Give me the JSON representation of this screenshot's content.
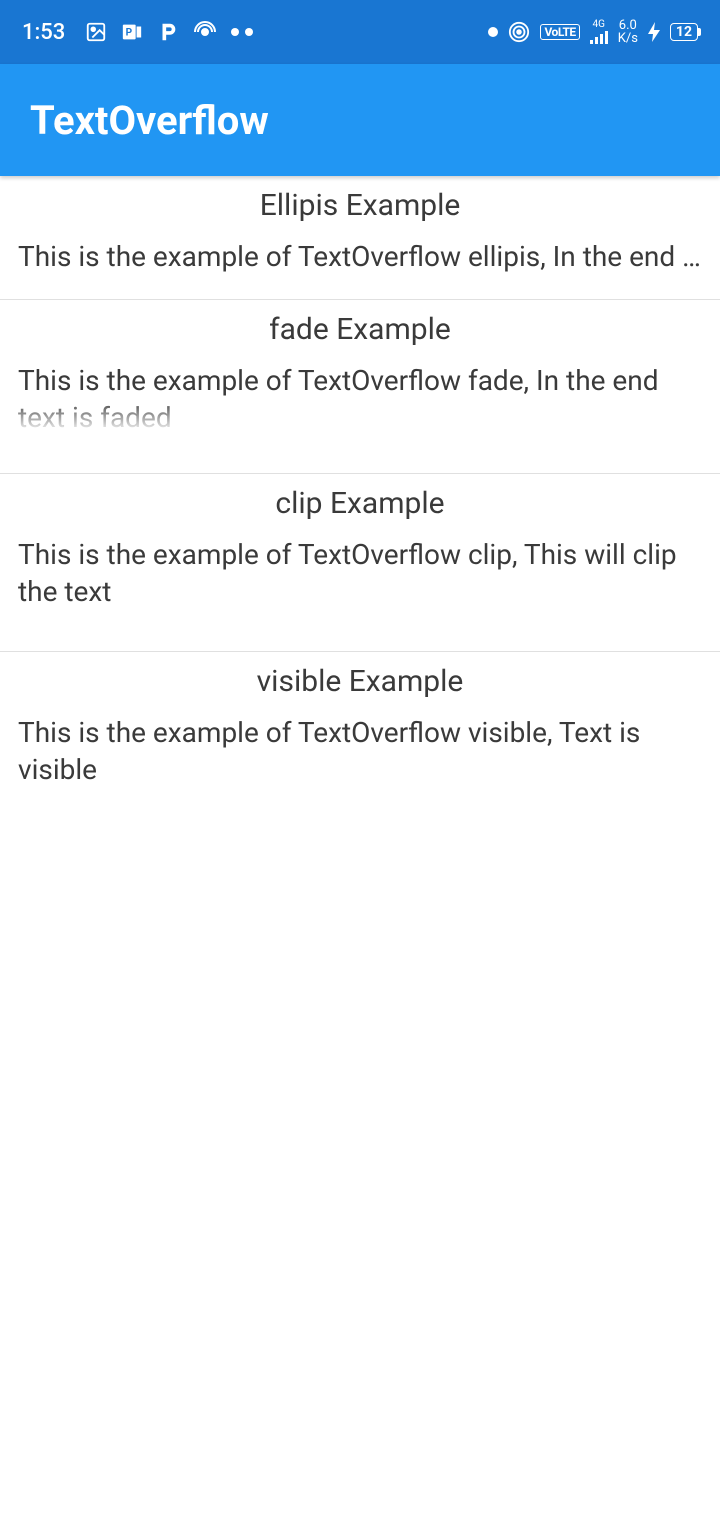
{
  "statusbar": {
    "time": "1:53",
    "volte": "VoLTE",
    "net_top": "4G",
    "speed_val": "6.0",
    "speed_unit": "K/s",
    "battery": "12"
  },
  "appbar": {
    "title": "TextOverflow"
  },
  "sections": [
    {
      "title": "Ellipis Example",
      "body": "This is the example of TextOverflow ellipis, In the end of the text an ellipsis is shown"
    },
    {
      "title": "fade Example",
      "body": "This is the example of TextOverflow fade, In the end text is faded"
    },
    {
      "title": "clip Example",
      "body": "This is the example of TextOverflow clip, This will clip the text"
    },
    {
      "title": "visible Example",
      "body": "This is the example of TextOverflow visible, Text is visible"
    }
  ]
}
